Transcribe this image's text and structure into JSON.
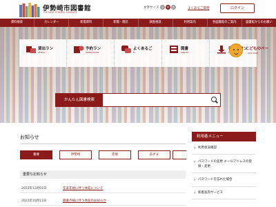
{
  "header": {
    "title": "伊勢崎市図書館",
    "subtitle": "ISESAKI PUBLIC LIBRARY",
    "fontsize_label": "文字サイズ",
    "fontsize_small": "小",
    "fontsize_mid": "中",
    "fontsize_big": "大",
    "faq": "よくあるご質問",
    "login": "ログイン"
  },
  "nav": {
    "items": [
      "資料検索",
      "カレンダー",
      "新着資料",
      "新聞・雑誌",
      "調査相談",
      "利用案内",
      "各図書館のご案内",
      "図書館からのお願い"
    ]
  },
  "quick": [
    {
      "label": "貸出ラン",
      "sub": "RENTAL I",
      "icon": "rental-icon"
    },
    {
      "label": "予約ラン",
      "sub": "RESERVATION",
      "icon": "reservation-icon"
    },
    {
      "label": "よくあるご",
      "sub": "FA",
      "icon": "faq-icon"
    },
    {
      "label": "図書",
      "sub": "LIBRARY",
      "icon": "library-icon"
    },
    {
      "label": "各種ダウン",
      "sub": "DOWNLO",
      "icon": "download-icon"
    }
  ],
  "kids": {
    "label": "こどものペー",
    "sub": "KIDS PAGE",
    "icon": "kids-face-icon"
  },
  "search": {
    "label": "かんたん図書検索",
    "placeholder": ""
  },
  "notices": {
    "title": "お知らせ",
    "tabs": [
      "重要",
      "伊勢崎",
      "赤堀",
      "あずま"
    ],
    "header": "重要なお知らせ",
    "rows": [
      {
        "date": "2022年12月01日",
        "text": "年末年始に伴う休館について"
      },
      {
        "date": "2022年10月11日",
        "text": "蔵書点検に伴う休館のお知らせ"
      }
    ]
  },
  "sidebar": {
    "title": "利用者メニュー",
    "items": [
      "利用状況確認",
      "パスワードの変更 メールアドレスの登録・変更",
      "パスワードを忘れた場合",
      "新着案内サービス"
    ]
  },
  "colors": {
    "brand": "#8b1a1a"
  }
}
